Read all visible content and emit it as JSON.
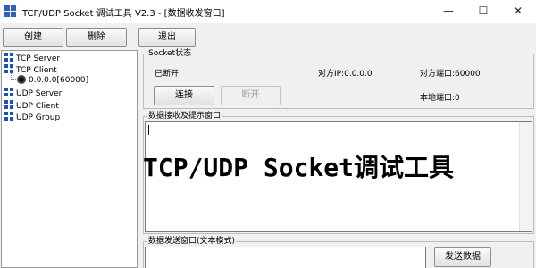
{
  "window": {
    "title": "TCP/UDP Socket 调试工具 V2.3 - [数据收发窗口]",
    "controls": {
      "minimize": "—",
      "maximize": "☐",
      "close": "✕"
    }
  },
  "toolbar": {
    "create": "创建",
    "delete": "删除",
    "exit": "退出"
  },
  "tree": {
    "items": [
      {
        "label": "TCP Server",
        "icon": "network-icon"
      },
      {
        "label": "TCP Client",
        "icon": "network-icon"
      },
      {
        "label": "0.0.0.0[60000]",
        "icon": "connection-icon"
      },
      {
        "label": "UDP Server",
        "icon": "network-icon"
      },
      {
        "label": "UDP Client",
        "icon": "network-icon"
      },
      {
        "label": "UDP Group",
        "icon": "network-icon"
      }
    ]
  },
  "socket_status": {
    "group_label": "Socket状态",
    "state": "已断开",
    "remote_ip": "对方IP:0.0.0.0",
    "remote_port": "对方端口:60000",
    "local_port": "本地端口:0",
    "connect_button": "连接",
    "disconnect_button": "断开"
  },
  "receive": {
    "group_label": "数据接收及提示窗口",
    "content": ""
  },
  "send": {
    "group_label": "数据发送窗口(文本模式)",
    "send_button": "发送数据"
  },
  "overlay_text": "TCP/UDP Socket调试工具"
}
